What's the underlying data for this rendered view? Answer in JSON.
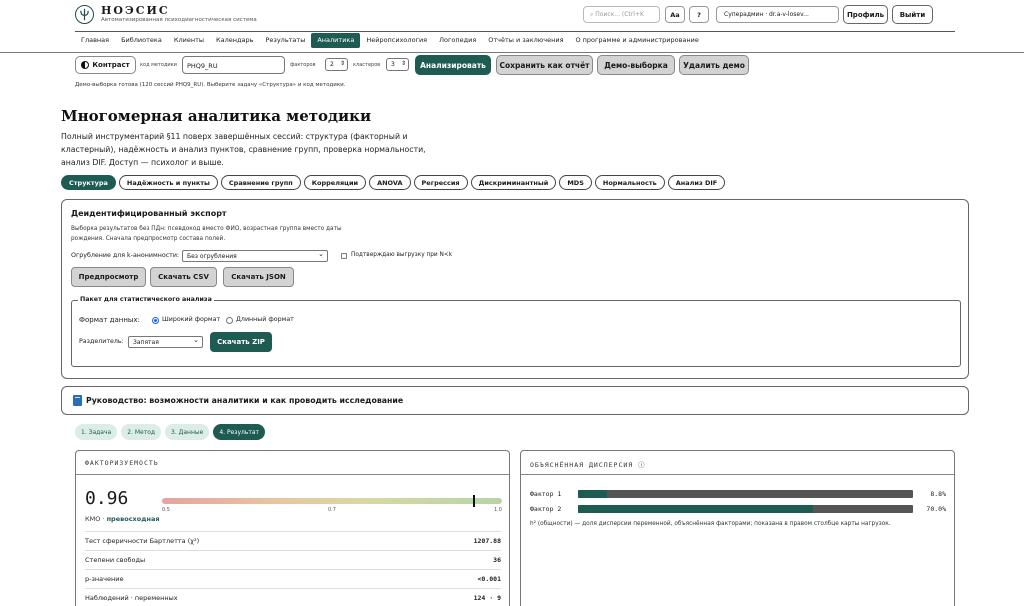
{
  "header": {
    "brand": "НОЭСИС",
    "brand_sub": "Автоматизированная психодиагностическая система",
    "search_placeholder": "⌕  Поиск... (Ctrl+K",
    "font_btn": "Aa",
    "help_btn": "?",
    "user": "Суперадмин  ·  dr.a-v-losev...",
    "profile_btn": "Профиль",
    "logout_btn": "Выйти"
  },
  "nav": {
    "items": [
      "Главная",
      "Библиотека",
      "Клиенты",
      "Календарь",
      "Результаты",
      "Аналитика",
      "Нейропсихология",
      "Логопедия",
      "Отчёты и заключения",
      "О программе и администрирование"
    ],
    "active": 5
  },
  "controls": {
    "contrast_btn": "Контраст",
    "code_label": "код методики",
    "code_value": "PHQ9_RU",
    "factors_label": "факторов",
    "factors_value": "2",
    "clusters_label": "кластеров",
    "clusters_value": "3",
    "analyze_btn": "Анализировать",
    "save_btn": "Сохранить как отчёт",
    "demo_btn": "Демо-выборка",
    "delete_demo_btn": "Удалить демо",
    "status": "Демо-выборка готова (120 сессий PHQ9_RU). Выберите задачу «Структура» и код методики."
  },
  "page": {
    "title": "Многомерная аналитика методики",
    "description": "Полный инструментарий §11 поверх завершённых сессий: структура (факторный и кластерный), надёжность и анализ пунктов, сравнение групп, проверка нормальности, анализ DIF. Доступ — психолог и выше."
  },
  "tabs": {
    "items": [
      "Структура",
      "Надёжность и пункты",
      "Сравнение групп",
      "Корреляции",
      "ANOVA",
      "Регрессия",
      "Дискриминантный",
      "MDS",
      "Нормальность",
      "Анализ DIF"
    ],
    "active": 0
  },
  "export": {
    "title": "Деидентифицированный экспорт",
    "description": "Выборка результатов без ПДн: псевдокод вместо ФИО, возрастная группа вместо даты рождения. Сначала предпросмотр состава полей.",
    "k_label": "Огрубление для k-анонимности:",
    "k_value": "Без огрубления",
    "confirm_label": "Подтверждаю выгрузку при N<k",
    "preview_btn": "Предпросмотр",
    "csv_btn": "Скачать CSV",
    "json_btn": "Скачать JSON",
    "package": {
      "legend": "Пакет для статистического анализа",
      "format_label": "Формат данных:",
      "wide": "Широкий формат",
      "long": "Длинный формат",
      "sep_label": "Разделитель:",
      "sep_value": "Запятая",
      "zip_btn": "Скачать ZIP"
    }
  },
  "guide": {
    "title": "Руководство: возможности аналитики и как проводить исследование"
  },
  "steps": {
    "items": [
      "1. Задача",
      "2. Метод",
      "3. Данные",
      "4. Результат"
    ],
    "active": 3
  },
  "factorability": {
    "title": "ФАКТОРИЗУЕМОСТЬ",
    "kmo": "0.96",
    "kmo_value": 0.96,
    "kmo_caption": "КМО ·",
    "kmo_grade": "превосходная",
    "ticks": [
      "0.5",
      "0.7",
      "1.0"
    ],
    "rows": [
      {
        "k": "Тест сферичности Бартлетта (χ²)",
        "v": "1207.88"
      },
      {
        "k": "Степени свободы",
        "v": "36"
      },
      {
        "k": "p-значение",
        "v": "<0.001"
      },
      {
        "k": "Наблюдений · переменных",
        "v": "124 · 9"
      }
    ]
  },
  "variance": {
    "title": "ОБЪЯСНЁННАЯ ДИСПЕРСИЯ  ⓘ",
    "rows": [
      {
        "k": "Фактор 1",
        "value": 8.8,
        "v": "8.8%"
      },
      {
        "k": "Фактор 2",
        "value": 70.0,
        "v": "70.0%"
      }
    ],
    "note": "h² (общности) — доля дисперсии переменной, объяснённая факторами; показана в правом столбце карты нагрузок."
  },
  "colors": {
    "accent": "#1e5b53",
    "bar_bg": "#555555"
  }
}
